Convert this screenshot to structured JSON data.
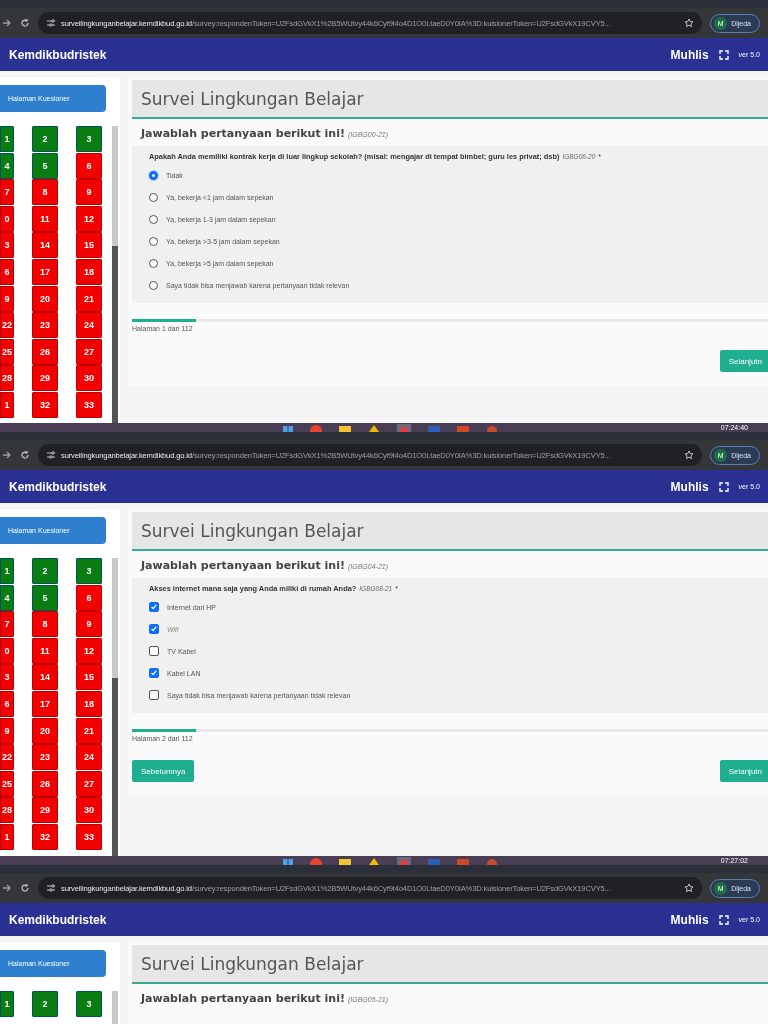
{
  "panels": [
    {
      "browser": {
        "host": "surveilingkunganbelajar.kemdikbud.go.id",
        "path": "/survey:respondenToken=U2FsdGVkX1%2B5WUtvy44k6Cyf9t4o4D1O0LtaeD0Y0IA%3D:kuisionerToken=U2FsdGVkX19CVY5...",
        "profile_initial": "M",
        "profile_name": "Dijeda"
      },
      "header": {
        "brand": "Kemdikbudristek",
        "user": "Muhlis",
        "version": "ver 5.0"
      },
      "sidebar": {
        "button": "Halaman Kuesioner",
        "pages": [
          {
            "label": "1",
            "answered": true
          },
          {
            "label": "2",
            "answered": true
          },
          {
            "label": "3",
            "answered": true
          },
          {
            "label": "4",
            "answered": true
          },
          {
            "label": "5",
            "answered": true
          },
          {
            "label": "6",
            "answered": false
          },
          {
            "label": "7",
            "answered": false
          },
          {
            "label": "8",
            "answered": false
          },
          {
            "label": "9",
            "answered": false
          },
          {
            "label": "0",
            "answered": false
          },
          {
            "label": "11",
            "answered": false
          },
          {
            "label": "12",
            "answered": false
          },
          {
            "label": "3",
            "answered": false
          },
          {
            "label": "14",
            "answered": false
          },
          {
            "label": "15",
            "answered": false
          },
          {
            "label": "6",
            "answered": false
          },
          {
            "label": "17",
            "answered": false
          },
          {
            "label": "18",
            "answered": false
          },
          {
            "label": "9",
            "answered": false
          },
          {
            "label": "20",
            "answered": false
          },
          {
            "label": "21",
            "answered": false
          },
          {
            "label": "22",
            "answered": false
          },
          {
            "label": "23",
            "answered": false
          },
          {
            "label": "24",
            "answered": false
          },
          {
            "label": "25",
            "answered": false
          },
          {
            "label": "26",
            "answered": false
          },
          {
            "label": "27",
            "answered": false
          },
          {
            "label": "28",
            "answered": false
          },
          {
            "label": "29",
            "answered": false
          },
          {
            "label": "30",
            "answered": false
          },
          {
            "label": "1",
            "answered": false
          },
          {
            "label": "32",
            "answered": false
          },
          {
            "label": "33",
            "answered": false
          }
        ]
      },
      "survey": {
        "title": "Survei Lingkungan Belajar",
        "instruction": "Jawablah pertanyaan berikut ini!",
        "instruction_code": "(IGBG00-21)",
        "question": {
          "kind": "radio",
          "text": "Apakah Anda memiliki kontrak kerja di luar lingkup sekolah? (misal: mengajar di tempat bimbel; guru les privat; dsb)",
          "code": "IGBG06-20",
          "required_mark": "*",
          "options": [
            {
              "label": "Tidak",
              "selected": true
            },
            {
              "label": "Ya, bekerja <1 jam dalam sepekan",
              "selected": false
            },
            {
              "label": "Ya, bekerja 1-3 jam dalam sepekan",
              "selected": false
            },
            {
              "label": "Ya, bekerja >3-5 jam dalam sepekan",
              "selected": false
            },
            {
              "label": "Ya, bekerja >5 jam dalam sepekan",
              "selected": false
            },
            {
              "label": "Saya tidak bisa menjawab karena pertanyaan tidak relevan",
              "selected": false
            }
          ]
        },
        "progress": {
          "level": 0.1,
          "text": "Halaman 1 dari 112"
        },
        "buttons": [
          {
            "kind": "next",
            "label": "Selanjutn"
          }
        ]
      },
      "taskbar": {
        "time": "07:24:40"
      }
    },
    {
      "browser": {
        "host": "surveilingkunganbelajar.kemdikbud.go.id",
        "path": "/survey:respondenToken=U2FsdGVkX1%2B5WUtvy44k6Cyf9t4o4D1O0LtaeD0Y0IA%3D:kuisionerToken=U2FsdGVkX19CVY5...",
        "profile_initial": "M",
        "profile_name": "Dijeda"
      },
      "header": {
        "brand": "Kemdikbudristek",
        "user": "Muhlis",
        "version": "ver 5.0"
      },
      "sidebar": {
        "button": "Halaman Kuesioner",
        "pages": [
          {
            "label": "1",
            "answered": true
          },
          {
            "label": "2",
            "answered": true
          },
          {
            "label": "3",
            "answered": true
          },
          {
            "label": "4",
            "answered": true
          },
          {
            "label": "5",
            "answered": true
          },
          {
            "label": "6",
            "answered": false
          },
          {
            "label": "7",
            "answered": false
          },
          {
            "label": "8",
            "answered": false
          },
          {
            "label": "9",
            "answered": false
          },
          {
            "label": "0",
            "answered": false
          },
          {
            "label": "11",
            "answered": false
          },
          {
            "label": "12",
            "answered": false
          },
          {
            "label": "3",
            "answered": false
          },
          {
            "label": "14",
            "answered": false
          },
          {
            "label": "15",
            "answered": false
          },
          {
            "label": "6",
            "answered": false
          },
          {
            "label": "17",
            "answered": false
          },
          {
            "label": "18",
            "answered": false
          },
          {
            "label": "9",
            "answered": false
          },
          {
            "label": "20",
            "answered": false
          },
          {
            "label": "21",
            "answered": false
          },
          {
            "label": "22",
            "answered": false
          },
          {
            "label": "23",
            "answered": false
          },
          {
            "label": "24",
            "answered": false
          },
          {
            "label": "25",
            "answered": false
          },
          {
            "label": "26",
            "answered": false
          },
          {
            "label": "27",
            "answered": false
          },
          {
            "label": "28",
            "answered": false
          },
          {
            "label": "29",
            "answered": false
          },
          {
            "label": "30",
            "answered": false
          },
          {
            "label": "1",
            "answered": false
          },
          {
            "label": "32",
            "answered": false
          },
          {
            "label": "33",
            "answered": false
          }
        ]
      },
      "survey": {
        "title": "Survei Lingkungan Belajar",
        "instruction": "Jawablah pertanyaan berikut ini!",
        "instruction_code": "(IGBG04-21)",
        "question": {
          "kind": "checkbox",
          "text": "Akses internet mana saja yang Anda miliki di rumah Anda?",
          "code": "IGBG08-21",
          "required_mark": "*",
          "options": [
            {
              "label": "Internet dari HP",
              "checked": true,
              "emphasis": false
            },
            {
              "label": "Wifi",
              "checked": true,
              "emphasis": true
            },
            {
              "label": "TV Kabel",
              "checked": false,
              "emphasis": false
            },
            {
              "label": "Kabel LAN",
              "checked": true,
              "emphasis": false
            },
            {
              "label": "Saya tidak bisa menjawab karena pertanyaan tidak relevan",
              "checked": false,
              "emphasis": false
            }
          ]
        },
        "progress": {
          "level": 0.1,
          "text": "Halaman 2 dari 112"
        },
        "buttons": [
          {
            "kind": "previous",
            "label": "Sebelumnya"
          },
          {
            "kind": "next",
            "label": "Selanjutn"
          }
        ]
      },
      "taskbar": {
        "time": "07:27:02"
      }
    },
    {
      "browser": {
        "host": "surveilingkunganbelajar.kemdikbud.go.id",
        "path": "/survey:respondenToken=U2FsdGVkX1%2B5WUtvy44k6Cyf9t4o4D1O0LtaeD0Y0IA%3D:kuisionerToken=U2FsdGVkX19CVY5...",
        "profile_initial": "M",
        "profile_name": "Dijeda"
      },
      "header": {
        "brand": "Kemdikbudristek",
        "user": "Muhlis",
        "version": "ver 5.0"
      },
      "sidebar": {
        "button": "Halaman Kuesioner",
        "pages": [
          {
            "label": "1",
            "answered": true
          },
          {
            "label": "2",
            "answered": true
          },
          {
            "label": "3",
            "answered": true
          }
        ]
      },
      "survey": {
        "title": "Survei Lingkungan Belajar",
        "instruction": "Jawablah pertanyaan berikut ini!",
        "instruction_code": "(IGBG05-21)"
      }
    }
  ]
}
